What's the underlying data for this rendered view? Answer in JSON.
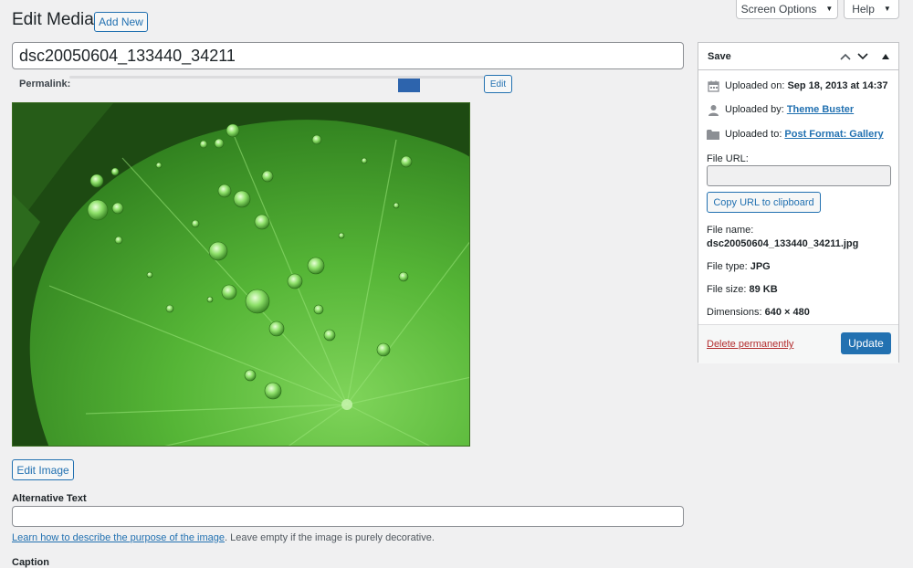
{
  "header": {
    "page_title": "Edit Media",
    "add_new": "Add New",
    "screen_options": "Screen Options",
    "help": "Help"
  },
  "editor": {
    "title_value": "dsc20050604_133440_34211",
    "permalink_label": "Permalink:",
    "permalink_edit": "Edit",
    "edit_image": "Edit Image",
    "alt_text_label": "Alternative Text",
    "alt_text_value": "",
    "alt_help_link": "Learn how to describe the purpose of the image",
    "alt_help_rest": ". Leave empty if the image is purely decorative.",
    "caption_label": "Caption"
  },
  "sidebar": {
    "title": "Save",
    "uploaded_on_label": "Uploaded on:",
    "uploaded_on_value": "Sep 18, 2013 at 14:37",
    "uploaded_by_label": "Uploaded by:",
    "uploaded_by_value": "Theme Buster",
    "uploaded_to_label": "Uploaded to:",
    "uploaded_to_value": "Post Format: Gallery",
    "file_url_label": "File URL:",
    "file_url_value": "",
    "copy_url": "Copy URL to clipboard",
    "file_name_label": "File name:",
    "file_name_value": "dsc20050604_133440_34211.jpg",
    "file_type_label": "File type:",
    "file_type_value": "JPG",
    "file_size_label": "File size:",
    "file_size_value": "89 KB",
    "dimensions_label": "Dimensions:",
    "dimensions_value": "640 × 480",
    "delete": "Delete permanently",
    "update": "Update"
  },
  "icons": [
    "calendar-icon",
    "user-icon",
    "folder-icon",
    "chevron-up-icon",
    "chevron-down-icon",
    "triangle-up-icon",
    "caret-down-icon"
  ],
  "colors": {
    "background": "#f0f0f1",
    "accent": "#2271b1",
    "delete": "#b32d2e",
    "leaf": "#4fae2f"
  }
}
